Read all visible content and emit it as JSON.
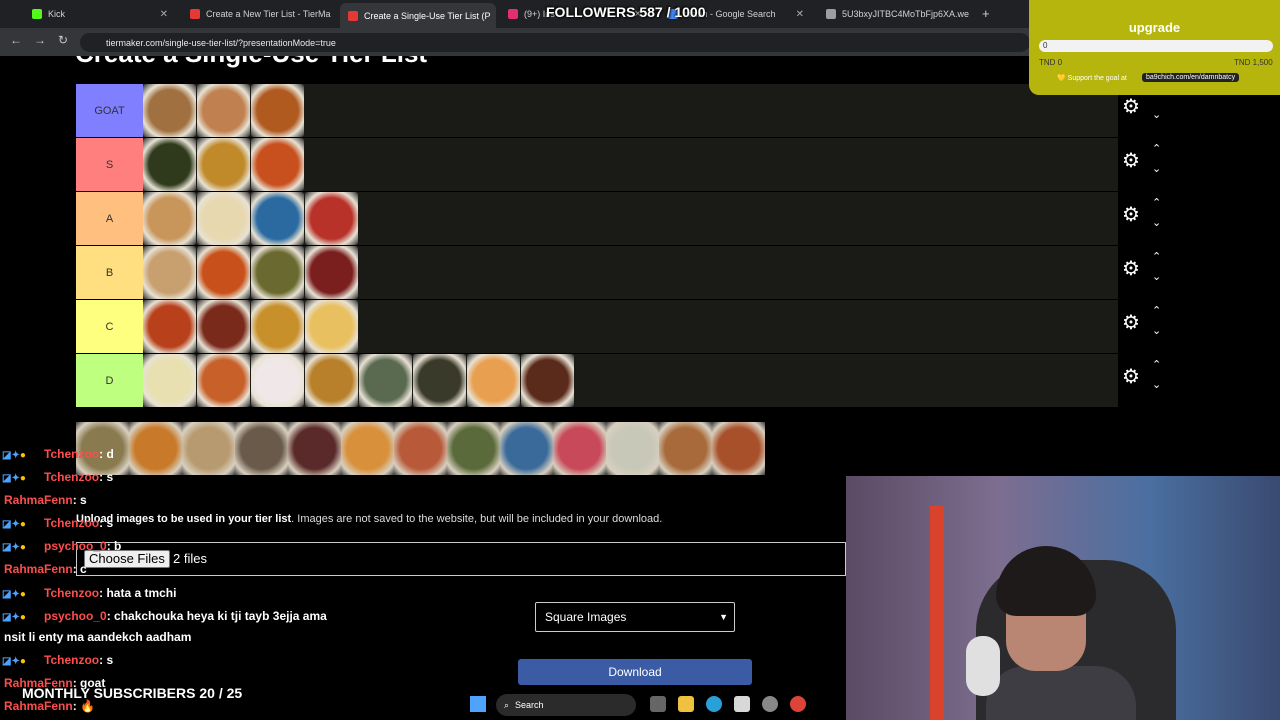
{
  "browser": {
    "tabs": [
      {
        "label": "Kick",
        "color": "#53fc18"
      },
      {
        "label": "Create a New Tier List - TierMa",
        "color": "#e53935"
      },
      {
        "label": "Create a Single-Use Tier List (P",
        "color": "#e53935"
      },
      {
        "label": "(9+) Ins",
        "color": "#e1306c"
      },
      {
        "label": "nisian - Google Search",
        "color": "#4285f4"
      },
      {
        "label": "5U3bxyJITBC4MoTbFjp6XA.we",
        "color": "#9e9e9e"
      }
    ],
    "new_tab": "+",
    "url": "tiermaker.com/single-use-tier-list/?presentationMode=true",
    "back": "←",
    "forward": "→",
    "reload": "↻"
  },
  "page": {
    "title": "Create a Single-Use Tier List",
    "tiers": [
      {
        "label": "GOAT",
        "color": "#7f7fff",
        "items": [
          "#a07040",
          "#c08050",
          "#b05a20"
        ]
      },
      {
        "label": "S",
        "color": "#ff7f7f",
        "items": [
          "#2f3a1c",
          "#c08a2a",
          "#c8501e"
        ]
      },
      {
        "label": "A",
        "color": "#ffbf7f",
        "items": [
          "#c8955a",
          "#e8d8b0",
          "#2a6aa0",
          "#b8322a"
        ]
      },
      {
        "label": "B",
        "color": "#ffdf7f",
        "items": [
          "#c8a070",
          "#c8501a",
          "#6a6a30",
          "#7a1e1e"
        ]
      },
      {
        "label": "C",
        "color": "#ffff7f",
        "items": [
          "#b8401a",
          "#7a2a1a",
          "#c8902a",
          "#e8c060"
        ]
      },
      {
        "label": "D",
        "color": "#bfff7f",
        "items": [
          "#e8e0b0",
          "#c8602a",
          "#f0e8e8",
          "#b8802a",
          "#5a6a50",
          "#3a3a2a",
          "#e8a050",
          "#5a2a1a"
        ]
      }
    ],
    "controls": {
      "gear": "⚙",
      "up": "⌃",
      "down": "⌄"
    },
    "pool_items": [
      "#8a7a50",
      "#c87a2a",
      "#b89a70",
      "#6a5a4a",
      "#5a2a2a",
      "#d8903a",
      "#b85a3a",
      "#5a6a3a",
      "#3a6a9a",
      "#c84a5a",
      "#c8c8b8",
      "#a86a3a",
      "#a8502a"
    ],
    "upload_note_bold": "Upload images to be used in your tier list",
    "upload_note_rest": ". Images are not saved to the website, but will be included in your download.",
    "choose_files": "Choose Files",
    "files_count": "2 files",
    "image_mode": "Square Images",
    "download": "Download"
  },
  "overlay": {
    "followers": "FOLLOWERS 587 / 1000",
    "goal": {
      "title": "upgrade",
      "value": "0",
      "min": "TND 0",
      "max": "TND 1,500",
      "support": "💛 Support the goal at",
      "link": "ba9chich.com/en/damnbatcy"
    },
    "chat": [
      {
        "user": "Tchenzoo",
        "text": ": d",
        "badges": true
      },
      {
        "user": "Tchenzoo",
        "text": ": s",
        "badges": true
      },
      {
        "user": "RahmaFenn",
        "text": ": s",
        "badges": false
      },
      {
        "user": "Tchenzoo",
        "text": ": s",
        "badges": true
      },
      {
        "user": "psychoo_0",
        "text": ": b",
        "badges": true
      },
      {
        "user": "RahmaFenn",
        "text": ": c",
        "badges": false
      },
      {
        "user": "Tchenzoo",
        "text": ": hata a tmchi",
        "badges": true
      },
      {
        "user": "psychoo_0",
        "text": ": chakchouka heya ki tji tayb 3ejja ama",
        "badges": true
      },
      {
        "user": "",
        "text": "nsit li enty ma aandekch aadham",
        "badges": false
      },
      {
        "user": "Tchenzoo",
        "text": ": s",
        "badges": true
      },
      {
        "user": "RahmaFenn",
        "text": ": goat",
        "badges": false
      },
      {
        "user": "RahmaFenn",
        "text": ": 🔥",
        "badges": false
      }
    ],
    "subscribers": "MONTHLY SUBSCRIBERS 20 / 25"
  },
  "taskbar": {
    "search": "Search"
  }
}
